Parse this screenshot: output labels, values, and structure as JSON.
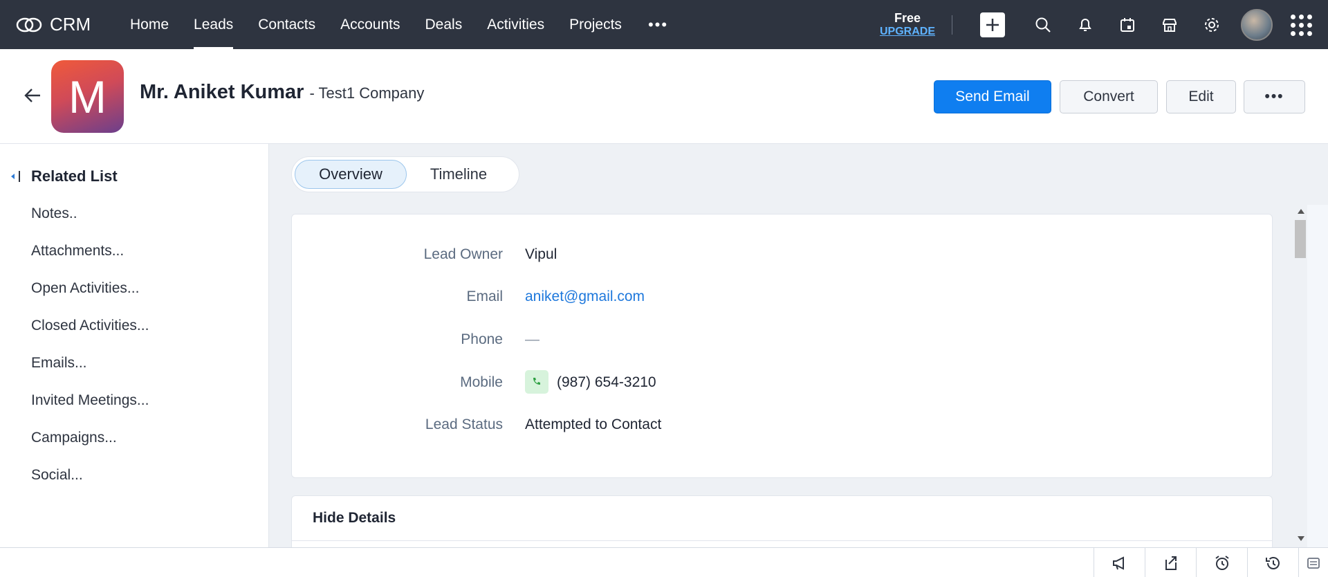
{
  "app": {
    "name": "CRM"
  },
  "nav": {
    "items": [
      {
        "label": "Home",
        "active": false
      },
      {
        "label": "Leads",
        "active": true
      },
      {
        "label": "Contacts",
        "active": false
      },
      {
        "label": "Accounts",
        "active": false
      },
      {
        "label": "Deals",
        "active": false
      },
      {
        "label": "Activities",
        "active": false
      },
      {
        "label": "Projects",
        "active": false
      }
    ],
    "more_label": "•••",
    "plan": {
      "label": "Free",
      "upgrade": "UPGRADE"
    }
  },
  "header": {
    "avatar_letter": "M",
    "name": "Mr. Aniket Kumar",
    "company": "- Test1 Company",
    "buttons": {
      "send_email": "Send Email",
      "convert": "Convert",
      "edit": "Edit",
      "more": "•••"
    }
  },
  "sidebar": {
    "title": "Related List",
    "items": [
      "Notes..",
      "Attachments...",
      "Open Activities...",
      "Closed Activities...",
      "Emails...",
      "Invited Meetings...",
      "Campaigns...",
      "Social..."
    ]
  },
  "tabs": [
    {
      "label": "Overview",
      "active": true
    },
    {
      "label": "Timeline",
      "active": false
    }
  ],
  "overview": {
    "fields": [
      {
        "label": "Lead Owner",
        "value": "Vipul"
      },
      {
        "label": "Email",
        "value": "aniket@gmail.com"
      },
      {
        "label": "Phone",
        "value": "—"
      },
      {
        "label": "Mobile",
        "value": "(987) 654-3210"
      },
      {
        "label": "Lead Status",
        "value": "Attempted to Contact"
      }
    ]
  },
  "details": {
    "title": "Hide Details"
  },
  "colors": {
    "topbar": "#2e3440",
    "primary": "#0f7ef0",
    "link": "#1e78dc",
    "upgrade": "#5fb3ff"
  },
  "icons": {
    "topbar": [
      "add-icon",
      "search-icon",
      "bell-icon",
      "calendar-icon",
      "store-icon",
      "gear-icon",
      "profile-avatar",
      "apps-grid-icon"
    ],
    "bottombar": [
      "megaphone-icon",
      "share-icon",
      "alarm-icon",
      "history-icon",
      "widgets-icon"
    ]
  }
}
